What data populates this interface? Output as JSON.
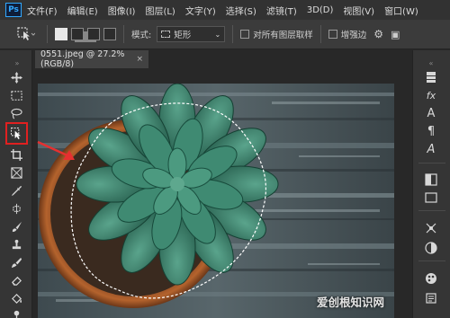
{
  "app": {
    "logo": "Ps",
    "menu": [
      "文件(F)",
      "编辑(E)",
      "图像(I)",
      "图层(L)",
      "文字(Y)",
      "选择(S)",
      "滤镜(T)",
      "3D(D)",
      "视图(V)",
      "窗口(W)"
    ]
  },
  "options_bar": {
    "style_label": "模式:",
    "style_value": "矩形",
    "sample_all_label": "对所有图层取样",
    "enhance_edge_label": "增强边"
  },
  "document": {
    "tab_title": "0551.jpeg @ 27.2%(RGB/8)",
    "close_glyph": "×"
  },
  "left_tools": [
    "move-tool",
    "marquee-tool",
    "lasso-tool",
    "object-selection-tool",
    "crop-tool",
    "frame-tool",
    "eyedropper-tool",
    "healing-brush-tool",
    "brush-tool",
    "clone-stamp-tool",
    "history-brush-tool",
    "eraser-tool",
    "gradient-tool"
  ],
  "right_panel_icons": [
    "layers-icon",
    "fx-icon",
    "text-icon",
    "paragraph-icon",
    "glyph-icon",
    "swatches-icon",
    "gradient-icon",
    "brush-settings-icon",
    "paths-icon",
    "color-icon",
    "adjustments-icon"
  ],
  "right_panel_glyphs": {
    "fx": "fx",
    "text": "A",
    "paragraph": "¶",
    "glyph": "A"
  },
  "colors": {
    "highlight": "#e02020",
    "arrow": "#e63030",
    "accent": "#31a8ff"
  },
  "watermark": "爱创根知识网"
}
